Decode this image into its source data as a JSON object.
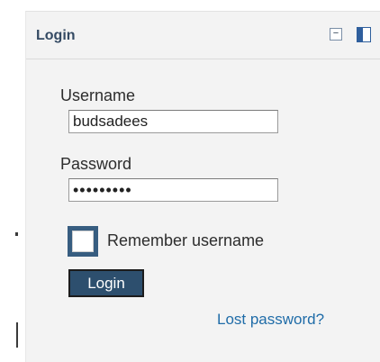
{
  "block": {
    "title": "Login",
    "hide_icon": "minus-box-icon",
    "dock_icon": "dock-icon",
    "accent_color": "#375d80"
  },
  "form": {
    "username_label": "Username",
    "username_value": "budsadees",
    "password_label": "Password",
    "password_value": "•••••••••",
    "remember_checked": false,
    "remember_label": "Remember username",
    "login_button": "Login",
    "lost_password_link": "Lost password?"
  }
}
